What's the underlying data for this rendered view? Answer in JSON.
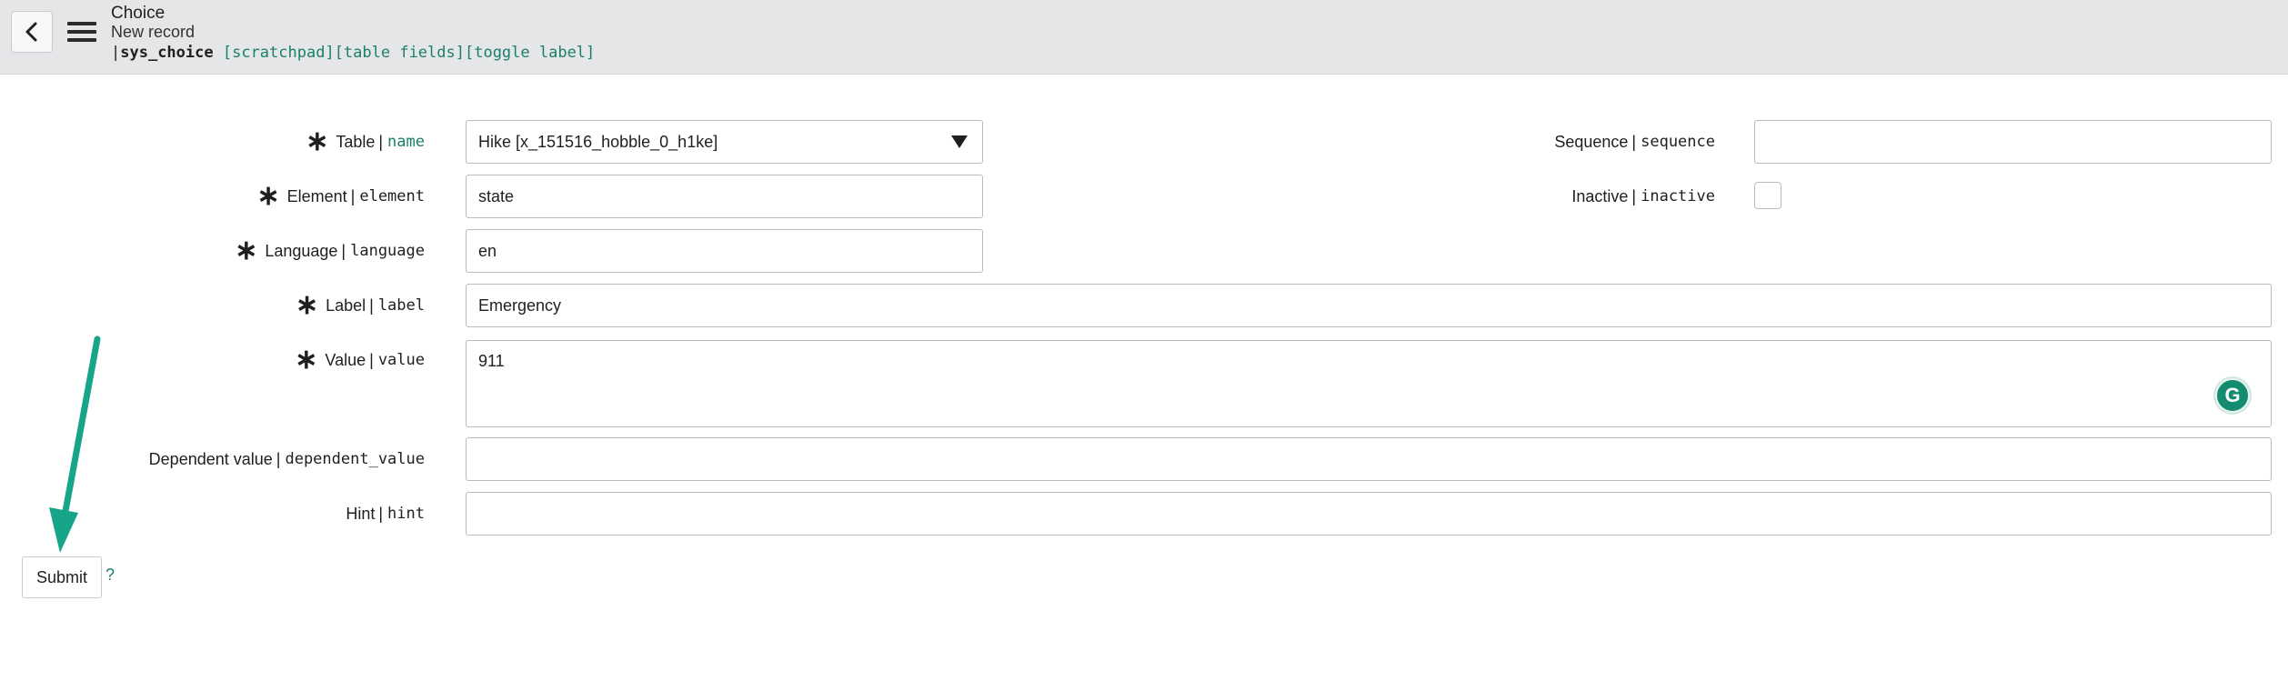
{
  "header": {
    "title": "Choice",
    "subtitle": "New record",
    "table_name": "sys_choice",
    "links": [
      "[scratchpad]",
      "[table fields]",
      "[toggle label]"
    ]
  },
  "form": {
    "table": {
      "label": "Table",
      "field": "name",
      "value": "Hike [x_151516_hobble_0_h1ke]"
    },
    "element": {
      "label": "Element",
      "field": "element",
      "value": "state"
    },
    "language": {
      "label": "Language",
      "field": "language",
      "value": "en"
    },
    "label_field": {
      "label": "Label",
      "field": "label",
      "value": "Emergency"
    },
    "value": {
      "label": "Value",
      "field": "value",
      "value": "911"
    },
    "dependent_value": {
      "label": "Dependent value",
      "field": "dependent_value",
      "value": ""
    },
    "hint": {
      "label": "Hint",
      "field": "hint",
      "value": ""
    },
    "sequence": {
      "label": "Sequence",
      "field": "sequence",
      "value": ""
    },
    "inactive": {
      "label": "Inactive",
      "field": "inactive",
      "checked": false
    }
  },
  "actions": {
    "submit_label": "Submit",
    "help_label": "?"
  },
  "icons": {
    "back": "chevron-left-icon",
    "menu": "hamburger-menu-icon",
    "grammarly": "grammarly-icon",
    "arrow": "annotation-arrow"
  },
  "colors": {
    "accent": "#1a7f6b",
    "arrow": "#17a589",
    "header_bg": "#e5e6e8"
  }
}
